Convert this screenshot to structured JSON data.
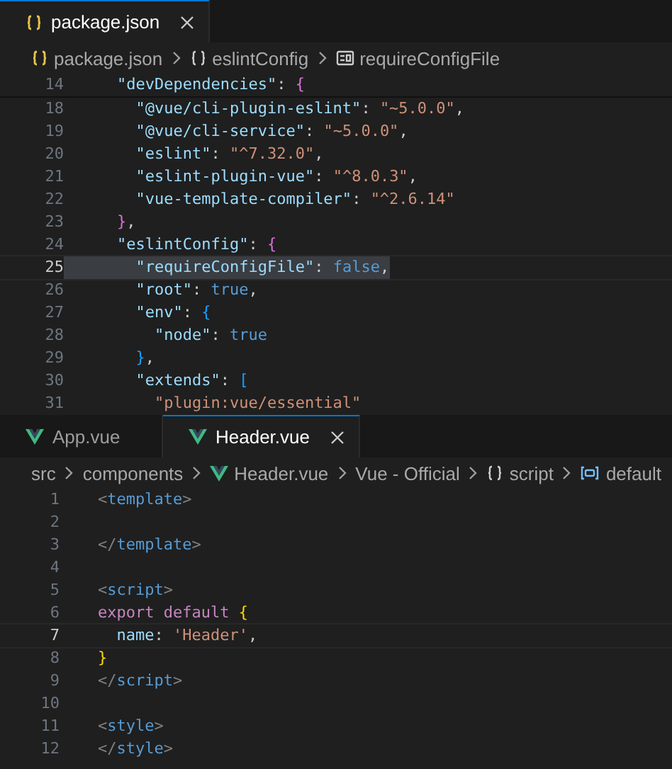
{
  "panes": [
    {
      "tabs": [
        {
          "label": "package.json",
          "kind": "json",
          "selected": true,
          "closable": true
        }
      ],
      "breadcrumb": [
        {
          "label": "package.json",
          "kind": "json"
        },
        {
          "label": "eslintConfig",
          "kind": "object"
        },
        {
          "label": "requireConfigFile",
          "kind": "property"
        }
      ],
      "sticky": {
        "number": "14",
        "current": false,
        "highlighted": false,
        "tokens": [
          {
            "text": "    \"devDependencies\"",
            "kind": "key"
          },
          {
            "text": ": ",
            "kind": "punct"
          },
          {
            "text": "{",
            "kind": "brace2"
          }
        ]
      },
      "lines": [
        {
          "number": "18",
          "current": false,
          "highlighted": false,
          "tokens": [
            {
              "text": "      \"@vue/cli-plugin-eslint\"",
              "kind": "key"
            },
            {
              "text": ": ",
              "kind": "punct"
            },
            {
              "text": "\"~5.0.0\"",
              "kind": "string"
            },
            {
              "text": ",",
              "kind": "punct"
            }
          ]
        },
        {
          "number": "19",
          "current": false,
          "highlighted": false,
          "tokens": [
            {
              "text": "      \"@vue/cli-service\"",
              "kind": "key"
            },
            {
              "text": ": ",
              "kind": "punct"
            },
            {
              "text": "\"~5.0.0\"",
              "kind": "string"
            },
            {
              "text": ",",
              "kind": "punct"
            }
          ]
        },
        {
          "number": "20",
          "current": false,
          "highlighted": false,
          "tokens": [
            {
              "text": "      \"eslint\"",
              "kind": "key"
            },
            {
              "text": ": ",
              "kind": "punct"
            },
            {
              "text": "\"^7.32.0\"",
              "kind": "string"
            },
            {
              "text": ",",
              "kind": "punct"
            }
          ]
        },
        {
          "number": "21",
          "current": false,
          "highlighted": false,
          "tokens": [
            {
              "text": "      \"eslint-plugin-vue\"",
              "kind": "key"
            },
            {
              "text": ": ",
              "kind": "punct"
            },
            {
              "text": "\"^8.0.3\"",
              "kind": "string"
            },
            {
              "text": ",",
              "kind": "punct"
            }
          ]
        },
        {
          "number": "22",
          "current": false,
          "highlighted": false,
          "tokens": [
            {
              "text": "      \"vue-template-compiler\"",
              "kind": "key"
            },
            {
              "text": ": ",
              "kind": "punct"
            },
            {
              "text": "\"^2.6.14\"",
              "kind": "string"
            }
          ]
        },
        {
          "number": "23",
          "current": false,
          "highlighted": false,
          "tokens": [
            {
              "text": "    }",
              "kind": "brace2"
            },
            {
              "text": ",",
              "kind": "punct"
            }
          ]
        },
        {
          "number": "24",
          "current": false,
          "highlighted": false,
          "tokens": [
            {
              "text": "    \"eslintConfig\"",
              "kind": "key"
            },
            {
              "text": ": ",
              "kind": "punct"
            },
            {
              "text": "{",
              "kind": "brace2"
            }
          ]
        },
        {
          "number": "25",
          "current": true,
          "highlighted": true,
          "tokens": [
            {
              "text": "      \"requireConfigFile\"",
              "kind": "key"
            },
            {
              "text": ": ",
              "kind": "punct"
            },
            {
              "text": "false",
              "kind": "bool"
            },
            {
              "text": ",",
              "kind": "punct"
            }
          ]
        },
        {
          "number": "26",
          "current": false,
          "highlighted": false,
          "tokens": [
            {
              "text": "      \"root\"",
              "kind": "key"
            },
            {
              "text": ": ",
              "kind": "punct"
            },
            {
              "text": "true",
              "kind": "bool"
            },
            {
              "text": ",",
              "kind": "punct"
            }
          ]
        },
        {
          "number": "27",
          "current": false,
          "highlighted": false,
          "tokens": [
            {
              "text": "      \"env\"",
              "kind": "key"
            },
            {
              "text": ": ",
              "kind": "punct"
            },
            {
              "text": "{",
              "kind": "brace3"
            }
          ]
        },
        {
          "number": "28",
          "current": false,
          "highlighted": false,
          "tokens": [
            {
              "text": "        \"node\"",
              "kind": "key"
            },
            {
              "text": ": ",
              "kind": "punct"
            },
            {
              "text": "true",
              "kind": "bool"
            }
          ]
        },
        {
          "number": "29",
          "current": false,
          "highlighted": false,
          "tokens": [
            {
              "text": "      }",
              "kind": "brace3"
            },
            {
              "text": ",",
              "kind": "punct"
            }
          ]
        },
        {
          "number": "30",
          "current": false,
          "highlighted": false,
          "tokens": [
            {
              "text": "      \"extends\"",
              "kind": "key"
            },
            {
              "text": ": ",
              "kind": "punct"
            },
            {
              "text": "[",
              "kind": "brace3"
            }
          ]
        },
        {
          "number": "31",
          "current": false,
          "highlighted": false,
          "tokens": [
            {
              "text": "        \"plugin:vue/essential\"",
              "kind": "string"
            }
          ]
        }
      ]
    },
    {
      "tabs": [
        {
          "label": "App.vue",
          "kind": "vue",
          "selected": false,
          "closable": false
        },
        {
          "label": "Header.vue",
          "kind": "vue",
          "selected": true,
          "closable": true
        }
      ],
      "breadcrumb": [
        {
          "label": "src",
          "kind": "folder"
        },
        {
          "label": "components",
          "kind": "folder"
        },
        {
          "label": "Header.vue",
          "kind": "vue"
        },
        {
          "label": "Vue - Official",
          "kind": "language"
        },
        {
          "label": "script",
          "kind": "object"
        },
        {
          "label": "default",
          "kind": "variable"
        }
      ],
      "lines": [
        {
          "number": "1",
          "current": false,
          "highlighted": false,
          "tokens": [
            {
              "text": "<",
              "kind": "tagpunct"
            },
            {
              "text": "template",
              "kind": "tag"
            },
            {
              "text": ">",
              "kind": "tagpunct"
            }
          ]
        },
        {
          "number": "2",
          "current": false,
          "highlighted": false
        },
        {
          "number": "3",
          "current": false,
          "highlighted": false,
          "tokens": [
            {
              "text": "</",
              "kind": "tagpunct"
            },
            {
              "text": "template",
              "kind": "tag"
            },
            {
              "text": ">",
              "kind": "tagpunct"
            }
          ]
        },
        {
          "number": "4",
          "current": false,
          "highlighted": false
        },
        {
          "number": "5",
          "current": false,
          "highlighted": false,
          "tokens": [
            {
              "text": "<",
              "kind": "tagpunct"
            },
            {
              "text": "script",
              "kind": "tag"
            },
            {
              "text": ">",
              "kind": "tagpunct"
            }
          ]
        },
        {
          "number": "6",
          "current": false,
          "highlighted": false,
          "tokens": [
            {
              "text": "export default",
              "kind": "keyword"
            },
            {
              "text": " {",
              "kind": "brace1"
            }
          ]
        },
        {
          "number": "7",
          "current": true,
          "highlighted": false,
          "tokens": [
            {
              "text": "  name",
              "kind": "key"
            },
            {
              "text": ": ",
              "kind": "punct"
            },
            {
              "text": "'Header'",
              "kind": "string"
            },
            {
              "text": ",",
              "kind": "punct"
            }
          ]
        },
        {
          "number": "8",
          "current": false,
          "highlighted": false,
          "tokens": [
            {
              "text": "}",
              "kind": "brace1"
            }
          ]
        },
        {
          "number": "9",
          "current": false,
          "highlighted": false,
          "tokens": [
            {
              "text": "</",
              "kind": "tagpunct"
            },
            {
              "text": "script",
              "kind": "tag"
            },
            {
              "text": ">",
              "kind": "tagpunct"
            }
          ]
        },
        {
          "number": "10",
          "current": false,
          "highlighted": false
        },
        {
          "number": "11",
          "current": false,
          "highlighted": false,
          "tokens": [
            {
              "text": "<",
              "kind": "tagpunct"
            },
            {
              "text": "style",
              "kind": "tag"
            },
            {
              "text": ">",
              "kind": "tagpunct"
            }
          ]
        },
        {
          "number": "12",
          "current": false,
          "highlighted": false,
          "tokens": [
            {
              "text": "</",
              "kind": "tagpunct"
            },
            {
              "text": "style",
              "kind": "tag"
            },
            {
              "text": ">",
              "kind": "tagpunct"
            }
          ]
        }
      ]
    }
  ]
}
